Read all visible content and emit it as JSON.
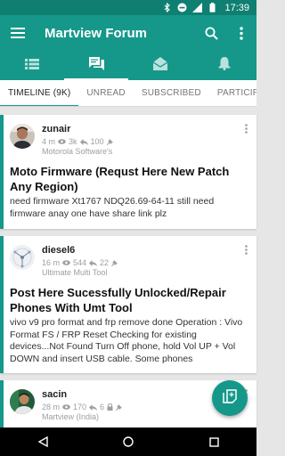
{
  "status_bar": {
    "time": "17:39",
    "icons": [
      "bluetooth-icon",
      "do-not-disturb-icon",
      "signal-icon",
      "battery-icon"
    ]
  },
  "app_bar": {
    "title": "Martview Forum",
    "menu_icon": "hamburger-menu-icon",
    "search_icon": "search-icon",
    "overflow_icon": "more-vertical-icon"
  },
  "icon_tabs": [
    {
      "name": "list-icon",
      "active": false
    },
    {
      "name": "forum-chat-icon",
      "active": true
    },
    {
      "name": "open-mail-icon",
      "active": false
    },
    {
      "name": "bell-icon",
      "active": false
    }
  ],
  "text_tabs": [
    {
      "label": "TIMELINE (9K)",
      "active": true
    },
    {
      "label": "UNREAD",
      "active": false
    },
    {
      "label": "SUBSCRIBED",
      "active": false
    },
    {
      "label": "PARTICIPATED",
      "active": false
    }
  ],
  "posts": [
    {
      "user": "zunair",
      "age": "4 m",
      "views": "3k",
      "replies": "100",
      "pinned": true,
      "locked": false,
      "forum": "Motorola Software's",
      "title": "Moto Firmware (Requst Here New Patch Any Region)",
      "body": "need firmware Xt1767 NDQ26.69-64-11 still need firmware anay one have share link plz"
    },
    {
      "user": "diesel6",
      "age": "16 m",
      "views": "544",
      "replies": "22",
      "pinned": true,
      "locked": false,
      "forum": "Ultimate Multi Tool",
      "title": "Post Here Sucessfully Unlocked/Repair Phones With Umt Tool",
      "body": "vivo v9 pro format and frp remove done Operation : Vivo Format FS / FRP Reset Checking for existing devices...Not Found Turn Off phone, hold Vol UP + Vol DOWN and insert USB cable. Some phones"
    },
    {
      "user": "sacin",
      "age": "28 m",
      "views": "170",
      "replies": "6",
      "pinned": true,
      "locked": true,
      "forum": "Martview (India)",
      "title": "",
      "body": ""
    }
  ],
  "fab_icon": "new-post-icon",
  "nav_bar": [
    "back-icon",
    "home-icon",
    "recents-icon"
  ],
  "colors": {
    "primary": "#15988a",
    "primary_dark": "#0f7f72",
    "background": "#e6e6e6"
  }
}
